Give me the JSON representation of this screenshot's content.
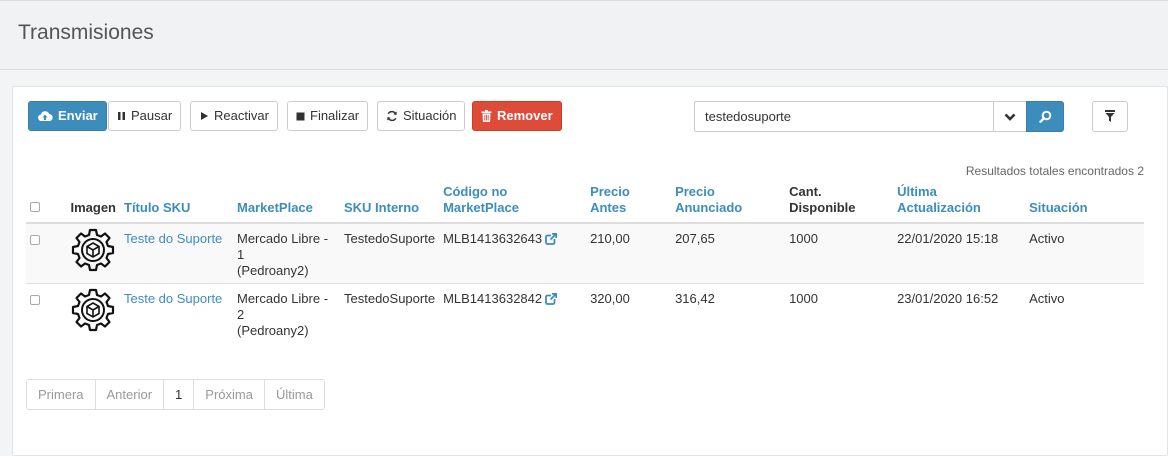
{
  "header": {
    "title": "Transmisiones"
  },
  "toolbar": {
    "send_label": "Enviar",
    "pause_label": "Pausar",
    "reactivate_label": "Reactivar",
    "finish_label": "Finalizar",
    "situation_label": "Situación",
    "remove_label": "Remover"
  },
  "search": {
    "value": "testedosuporte"
  },
  "results_text": "Resultados totales encontrados 2",
  "table": {
    "columns": {
      "image": "Imagen",
      "title": "Título SKU",
      "marketplace": "MarketPlace",
      "sku": "SKU Interno",
      "code_line1": "Código no",
      "code_line2": "MarketPlace",
      "price_before_line1": "Precio",
      "price_before_line2": "Antes",
      "price_listed_line1": "Precio",
      "price_listed_line2": "Anunciado",
      "qty_line1": "Cant.",
      "qty_line2": "Disponible",
      "updated_line1": "Última",
      "updated_line2": "Actualización",
      "status": "Situación"
    },
    "rows": [
      {
        "title": "Teste do Suporte",
        "mp_line1": "Mercado Libre -",
        "mp_line2": "1",
        "mp_line3": "(Pedroany2)",
        "sku": "TestedoSuporte",
        "code": "MLB1413632643",
        "price_before": "210,00",
        "price_listed": "207,65",
        "qty": "1000",
        "updated": "22/01/2020 15:18",
        "status": "Activo"
      },
      {
        "title": "Teste do Suporte",
        "mp_line1": "Mercado Libre -",
        "mp_line2": "2",
        "mp_line3": "(Pedroany2)",
        "sku": "TestedoSuporte",
        "code": "MLB1413632842",
        "price_before": "320,00",
        "price_listed": "316,42",
        "qty": "1000",
        "updated": "23/01/2020 16:52",
        "status": "Activo"
      }
    ]
  },
  "pagination": {
    "first": "Primera",
    "previous": "Anterior",
    "current": "1",
    "next": "Próxima",
    "last": "Última"
  },
  "colors": {
    "primary": "#3c8dbc",
    "danger": "#dd4b39"
  },
  "icons": [
    "cloud-upload-icon",
    "pause-icon",
    "play-icon",
    "stop-icon",
    "refresh-icon",
    "trash-icon",
    "chevron-down-icon",
    "search-icon",
    "filter-icon",
    "external-link-icon",
    "gear-box-icon"
  ]
}
